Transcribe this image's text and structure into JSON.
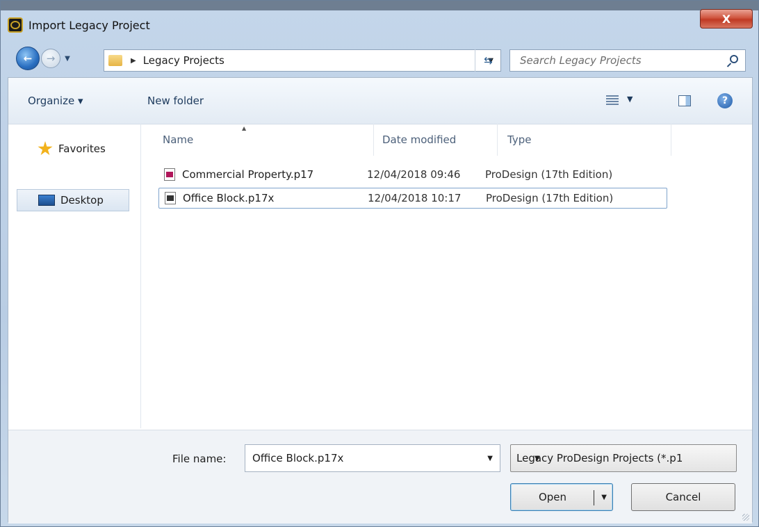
{
  "window": {
    "title": "Import Legacy Project",
    "close_label": "X"
  },
  "nav": {
    "address_path": "Legacy Projects",
    "search_placeholder": "Search Legacy Projects"
  },
  "toolbar": {
    "organize_label": "Organize ▾",
    "new_folder_label": "New folder"
  },
  "sidebar": {
    "items": [
      {
        "label": "Favorites",
        "icon": "star-icon"
      },
      {
        "label": "Desktop",
        "icon": "desktop-icon"
      }
    ]
  },
  "columns": [
    "Name",
    "Date modified",
    "Type"
  ],
  "files": [
    {
      "name": "Commercial Property.p17",
      "date": "12/04/2018 09:46",
      "type": "ProDesign (17th Edition)",
      "icon_color": "#b0175a"
    },
    {
      "name": "Office Block.p17x",
      "date": "12/04/2018 10:17",
      "type": "ProDesign (17th Edition)",
      "icon_color": "#333333"
    }
  ],
  "bottom": {
    "file_name_label": "File name:",
    "file_name_value": "Office Block.p17x",
    "filter_value": "Legacy ProDesign Projects (*.p1",
    "open_label": "Open",
    "cancel_label": "Cancel"
  }
}
